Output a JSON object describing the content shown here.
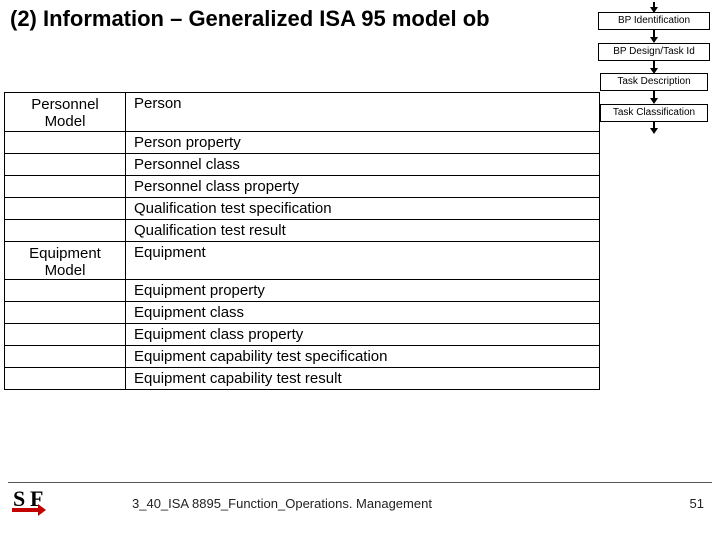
{
  "title": "(2) Information – Generalized ISA 95 model ob",
  "right_boxes": {
    "b1": "BP Identification",
    "b2": "BP Design/Task Id",
    "b3": "Task Description",
    "b4": "Task Classification"
  },
  "models": {
    "personnel": {
      "heading_line1": "Personnel",
      "heading_line2": "Model",
      "rows": [
        "Person",
        "Person property",
        "Personnel class",
        "Personnel class property",
        "Qualification test specification",
        "Qualification test result"
      ]
    },
    "equipment": {
      "heading_line1": "Equipment",
      "heading_line2": "Model",
      "rows": [
        "Equipment",
        "Equipment property",
        "Equipment class",
        "Equipment class property",
        "Equipment capability test specification",
        "Equipment capability test result"
      ]
    }
  },
  "footer": {
    "text": "3_40_ISA 8895_Function_Operations. Management",
    "page": "51"
  }
}
